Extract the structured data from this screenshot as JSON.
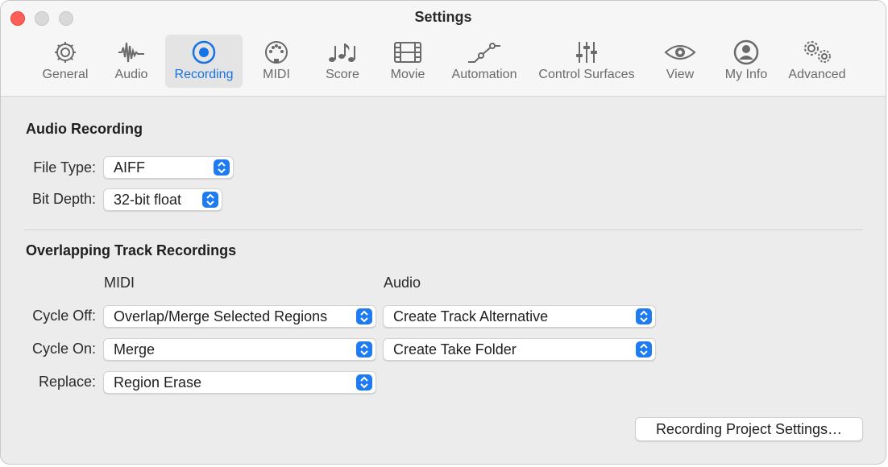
{
  "window": {
    "title": "Settings"
  },
  "tabs": [
    {
      "label": "General",
      "icon": "gear-icon"
    },
    {
      "label": "Audio",
      "icon": "waveform-icon"
    },
    {
      "label": "Recording",
      "icon": "record-icon",
      "active": true
    },
    {
      "label": "MIDI",
      "icon": "midi-connector-icon"
    },
    {
      "label": "Score",
      "icon": "music-notes-icon"
    },
    {
      "label": "Movie",
      "icon": "film-icon"
    },
    {
      "label": "Automation",
      "icon": "automation-curve-icon"
    },
    {
      "label": "Control Surfaces",
      "icon": "faders-icon"
    },
    {
      "label": "View",
      "icon": "eye-icon"
    },
    {
      "label": "My Info",
      "icon": "person-icon"
    },
    {
      "label": "Advanced",
      "icon": "gears-icon"
    }
  ],
  "audio_recording": {
    "title": "Audio Recording",
    "file_type": {
      "label": "File Type:",
      "value": "AIFF"
    },
    "bit_depth": {
      "label": "Bit Depth:",
      "value": "32-bit float"
    }
  },
  "overlapping": {
    "title": "Overlapping Track Recordings",
    "col_midi": "MIDI",
    "col_audio": "Audio",
    "cycle_off": {
      "label": "Cycle Off:",
      "midi": "Overlap/Merge Selected Regions",
      "audio": "Create Track Alternative"
    },
    "cycle_on": {
      "label": "Cycle On:",
      "midi": "Merge",
      "audio": "Create Take Folder"
    },
    "replace": {
      "label": "Replace:",
      "midi": "Region Erase"
    }
  },
  "buttons": {
    "project_settings": "Recording Project Settings…"
  },
  "colors": {
    "accent": "#1f7bf2",
    "close": "#ff5f57"
  }
}
